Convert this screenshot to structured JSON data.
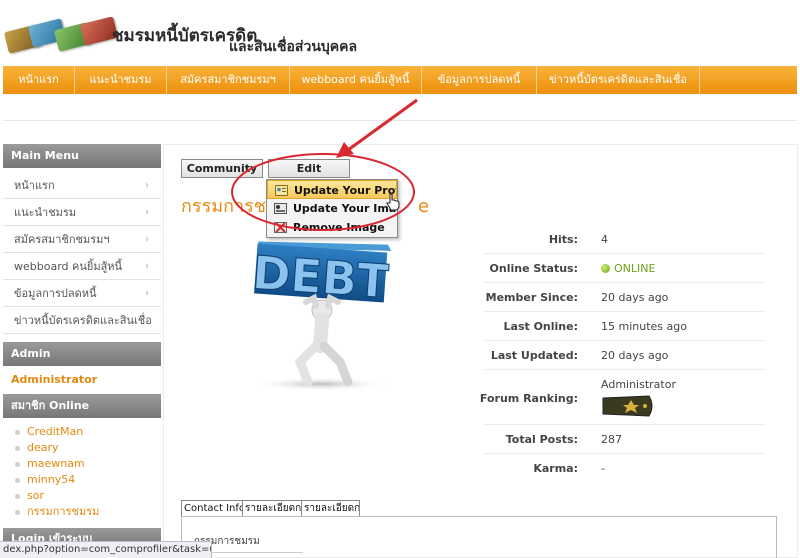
{
  "header": {
    "title_line1": "ชมรมหนี้บัตรเครดิต",
    "title_line2": "และสินเชื่อส่วนบุคคล"
  },
  "nav": {
    "items": [
      "หน้าแรก",
      "แนะนำชมรม",
      "สมัครสมาชิกชมรมฯ",
      "webboard คนยิ้มสู้หนี้",
      "ข้อมูลการปลดหนี้",
      "ข่าวหนี้บัตรเครดิตและสินเชื่อ"
    ]
  },
  "sidebar": {
    "main_menu_title": "Main Menu",
    "main_menu": [
      "หน้าแรก",
      "แนะนำชมรม",
      "สมัครสมาชิกชมรมฯ",
      "webboard คนยิ้มสู้หนี้",
      "ข้อมูลการปลดหนี้",
      "ข่าวหนี้บัตรเครดิตและสินเชื่อ"
    ],
    "admin_title": "Admin",
    "admin_name": "Administrator",
    "online_title": "สมาชิก Online",
    "online_users": [
      "CreditMan",
      "deary",
      "maewnam",
      "minny54",
      "sor",
      "กรรมการชมรม"
    ],
    "login_title": "Login เข้าระบบ"
  },
  "profile": {
    "community_button": "Community",
    "edit_button": "Edit",
    "heading_left": "กรรมการช",
    "heading_right": "e",
    "dropdown": [
      "Update Your Profile",
      "Update Your Image",
      "Remove Image"
    ],
    "avatar_text": "DEBT",
    "fields": [
      {
        "label": "Hits:",
        "value": "4"
      },
      {
        "label": "Online Status:",
        "value": "ONLINE"
      },
      {
        "label": "Member Since:",
        "value": "20 days ago"
      },
      {
        "label": "Last Online:",
        "value": "15 minutes ago"
      },
      {
        "label": "Last Updated:",
        "value": "20 days ago"
      },
      {
        "label": "Forum Ranking:",
        "value": "Administrator"
      },
      {
        "label": "Total Posts:",
        "value": "287"
      },
      {
        "label": "Karma:",
        "value": "-"
      }
    ],
    "tabs": [
      "Contact Info",
      "รายละเอียดการ",
      "รายละเอียดการ"
    ],
    "panel_text": "กรรมการชมรม"
  },
  "status_bar": "dex.php?option=com_comprofiler&task=user...",
  "colors": {
    "accent": "#e98a13",
    "nav_top": "#f7b33a",
    "nav_bottom": "#ee8f0c",
    "online": "#6aa51a",
    "annotation": "#d9282f"
  }
}
